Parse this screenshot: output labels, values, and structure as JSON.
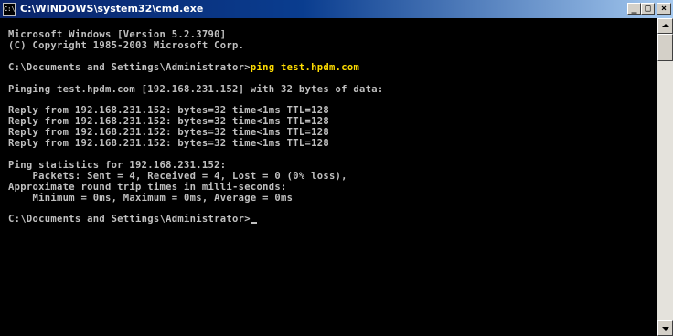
{
  "window": {
    "title": "C:\\WINDOWS\\system32\\cmd.exe",
    "icon_label": "C:\\",
    "minimize_label": "_",
    "maximize_label": "□",
    "close_label": "×"
  },
  "console": {
    "lines": [
      {
        "text": "Microsoft Windows [Version 5.2.3790]"
      },
      {
        "text": "(C) Copyright 1985-2003 Microsoft Corp."
      },
      {
        "text": ""
      },
      {
        "prompt": "C:\\Documents and Settings\\Administrator>",
        "command": "ping test.hpdm.com"
      },
      {
        "text": ""
      },
      {
        "text": "Pinging test.hpdm.com [192.168.231.152] with 32 bytes of data:"
      },
      {
        "text": ""
      },
      {
        "text": "Reply from 192.168.231.152: bytes=32 time<1ms TTL=128"
      },
      {
        "text": "Reply from 192.168.231.152: bytes=32 time<1ms TTL=128"
      },
      {
        "text": "Reply from 192.168.231.152: bytes=32 time<1ms TTL=128"
      },
      {
        "text": "Reply from 192.168.231.152: bytes=32 time<1ms TTL=128"
      },
      {
        "text": ""
      },
      {
        "text": "Ping statistics for 192.168.231.152:"
      },
      {
        "text": "    Packets: Sent = 4, Received = 4, Lost = 0 (0% loss),"
      },
      {
        "text": "Approximate round trip times in milli-seconds:"
      },
      {
        "text": "    Minimum = 0ms, Maximum = 0ms, Average = 0ms"
      },
      {
        "text": ""
      },
      {
        "prompt": "C:\\Documents and Settings\\Administrator>",
        "command": ""
      }
    ]
  },
  "colors": {
    "background": "#000000",
    "text": "#c0c0c0",
    "command_text": "#ffdd00",
    "titlebar_start": "#0a246a",
    "titlebar_end": "#a6caf0"
  },
  "icons": {
    "app": "cmd-icon",
    "scroll_up": "arrow-up-icon",
    "scroll_down": "arrow-down-icon"
  }
}
